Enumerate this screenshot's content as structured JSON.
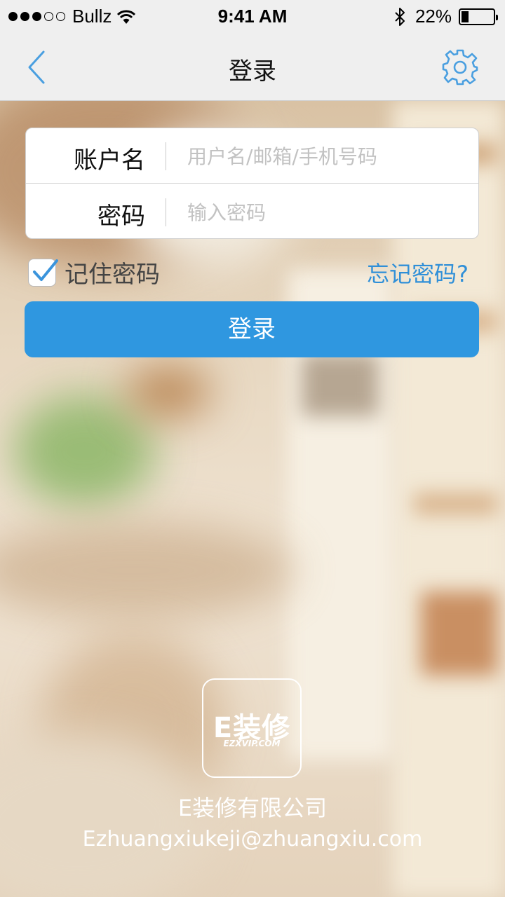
{
  "status_bar": {
    "signal_bars_filled": 3,
    "signal_bars_total": 5,
    "carrier": "Bullz",
    "time": "9:41 AM",
    "battery_percent": "22%",
    "battery_level": 0.22,
    "icons": [
      "wifi-icon",
      "bluetooth-icon",
      "battery-icon"
    ]
  },
  "nav": {
    "title": "登录",
    "back_icon": "chevron-left-icon",
    "settings_icon": "gear-icon",
    "accent_color": "#4a9fe0"
  },
  "form": {
    "username_label": "账户名",
    "username_placeholder": "用户名/邮箱/手机号码",
    "password_label": "密码",
    "password_placeholder": "输入密码"
  },
  "options": {
    "remember_label": "记住密码",
    "remember_checked": true,
    "forgot_label": "忘记密码?"
  },
  "login_button": {
    "label": "登录",
    "color": "#2f97e0"
  },
  "footer": {
    "logo_text": "E装修",
    "logo_subtext": "EZXVIP.COM",
    "company": "E装修有限公司",
    "email": "Ezhuangxiukeji@zhuangxiu.com"
  }
}
